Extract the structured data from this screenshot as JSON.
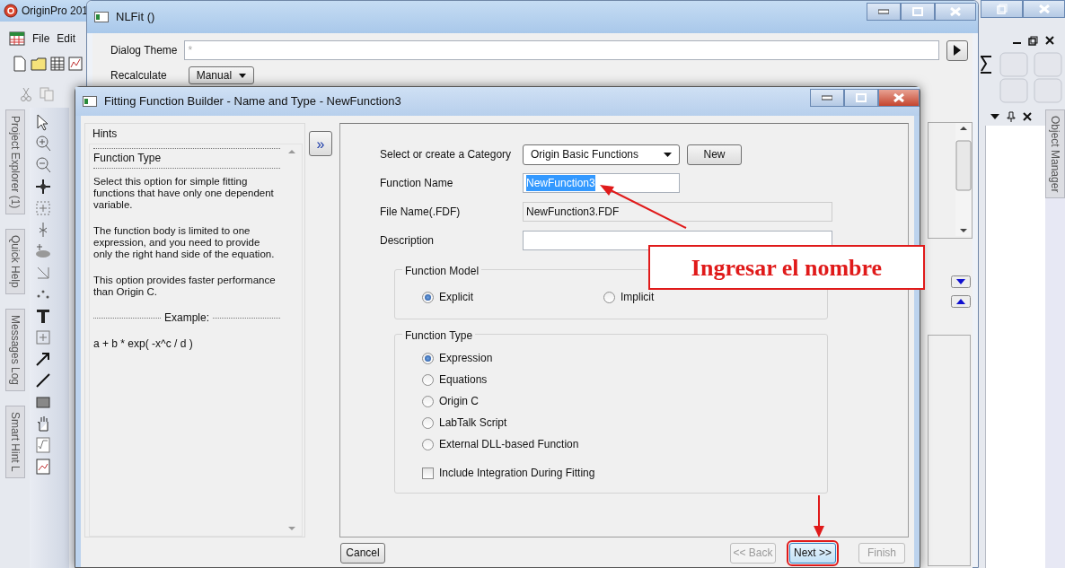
{
  "app": {
    "title": "OriginPro 201",
    "menu": [
      "File",
      "Edit"
    ],
    "side_tabs": [
      "Project Explorer (1)",
      "Quick Help",
      "Messages Log",
      "Smart Hint L"
    ],
    "right_tab": "Object Manager"
  },
  "nlfit": {
    "title": "NLFit ()",
    "theme_label": "Dialog Theme",
    "theme_value": "*",
    "recalc_label": "Recalculate",
    "recalc_value": "Manual"
  },
  "builder": {
    "title": "Fitting Function Builder - Name and Type - NewFunction3",
    "hints": {
      "title": "Hints",
      "heading": "Function Type",
      "paragraphs": [
        "Select this option for simple fitting functions that have only one dependent variable.",
        "The function body is limited to one expression, and you need to provide only the right hand side of the equation.",
        "This option provides faster performance than Origin C."
      ],
      "example_label": "Example:",
      "example": "a + b * exp( -x^c / d )"
    },
    "expand_button": "»",
    "fields": [
      {
        "kind": "select",
        "label": "Select or create a Category",
        "value": "Origin Basic Functions",
        "button": "New"
      },
      {
        "kind": "text",
        "label": "Function Name",
        "value": "NewFunction3",
        "text_selected": true
      },
      {
        "kind": "readonly",
        "label": "File Name(.FDF)",
        "value": "NewFunction3.FDF"
      },
      {
        "kind": "wide",
        "label": "Description"
      }
    ],
    "groups": [
      {
        "title": "Function Model",
        "kind": "row",
        "options": [
          {
            "label": "Explicit",
            "selected": true
          },
          {
            "label": "Implicit",
            "selected": false
          }
        ]
      },
      {
        "title": "Function Type",
        "kind": "column",
        "options": [
          {
            "label": "Expression",
            "selected": true
          },
          {
            "label": "Equations",
            "selected": false
          },
          {
            "label": "Origin C",
            "selected": false
          },
          {
            "label": "LabTalk Script",
            "selected": false
          },
          {
            "label": "External DLL-based Function",
            "selected": false
          }
        ],
        "checkbox": {
          "label": "Include Integration During Fitting",
          "checked": false
        }
      }
    ],
    "buttons": [
      {
        "label": "Cancel",
        "disabled": false,
        "highlighted": false
      },
      {
        "label": "<< Back",
        "disabled": true,
        "highlighted": false
      },
      {
        "label": "Next >>",
        "disabled": false,
        "highlighted": true
      },
      {
        "label": "Finish",
        "disabled": true,
        "highlighted": false
      }
    ]
  },
  "annotation": {
    "text": "Ingresar el nombre"
  }
}
